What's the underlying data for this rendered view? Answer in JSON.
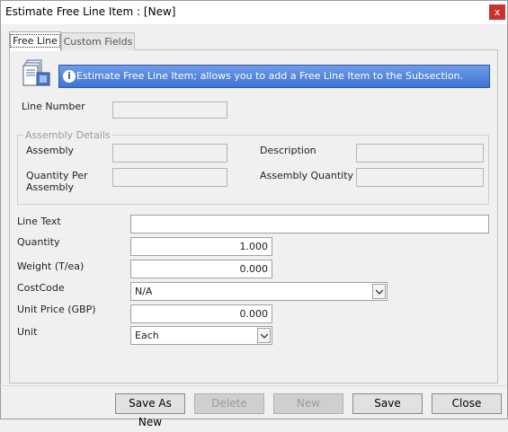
{
  "window": {
    "title": "Estimate Free Line Item : [New]",
    "close_glyph": "x"
  },
  "tabs": [
    {
      "label": "Free Line",
      "active": true
    },
    {
      "label": "Custom Fields",
      "active": false
    }
  ],
  "banner": {
    "icon": "info-icon",
    "info_glyph": "i",
    "text": "Estimate Free Line Item; allows you to add a Free Line Item to the Subsection."
  },
  "fields": {
    "line_number": {
      "label": "Line Number",
      "value": ""
    },
    "assembly_group": {
      "label": "Assembly Details"
    },
    "assembly": {
      "label": "Assembly",
      "value": ""
    },
    "description": {
      "label": "Description",
      "value": ""
    },
    "quantity_per_assembly": {
      "label_line1": "Quantity Per",
      "label_line2": "Assembly",
      "value": ""
    },
    "assembly_quantity": {
      "label": "Assembly Quantity",
      "value": ""
    },
    "line_text": {
      "label": "Line Text",
      "value": ""
    },
    "quantity": {
      "label": "Quantity",
      "value": "1.000"
    },
    "weight": {
      "label": "Weight (T/ea)",
      "value": "0.000"
    },
    "cost_code": {
      "label": "CostCode",
      "value": "N/A"
    },
    "unit_price": {
      "label": "Unit Price (GBP)",
      "value": "0.000"
    },
    "unit": {
      "label": "Unit",
      "value": "Each"
    }
  },
  "buttons": {
    "save_as_new": "Save As New",
    "delete": "Delete",
    "new": "New",
    "save": "Save",
    "close": "Close"
  }
}
